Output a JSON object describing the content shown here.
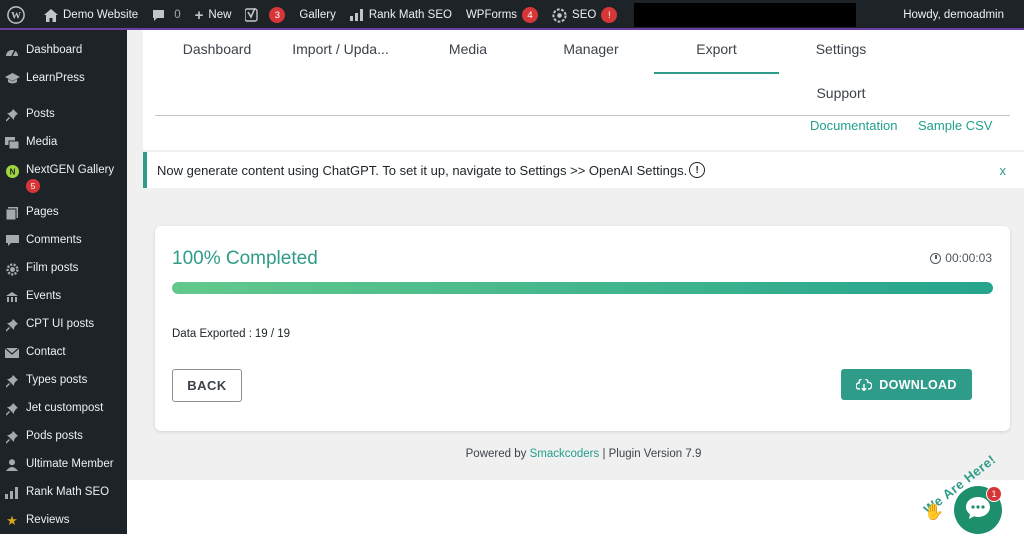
{
  "adminbar": {
    "site_name": "Demo Website",
    "comments_count": "0",
    "new_label": "New",
    "yoast_badge": "3",
    "gallery_label": "Gallery",
    "rankmath_label": "Rank Math SEO",
    "wpforms_label": "WPForms",
    "wpforms_badge": "4",
    "seo_label": "SEO",
    "seo_badge": "!",
    "howdy": "Howdy, demoadmin"
  },
  "sidebar": {
    "items": [
      {
        "label": "Dashboard",
        "icon": "dashboard-icon"
      },
      {
        "label": "LearnPress",
        "icon": "graduation-cap-icon"
      },
      {
        "label": "Posts",
        "icon": "pin-icon"
      },
      {
        "label": "Media",
        "icon": "media-icon"
      },
      {
        "label": "NextGEN Gallery",
        "icon": "gallery-icon",
        "badge": "5"
      },
      {
        "label": "Pages",
        "icon": "pages-icon"
      },
      {
        "label": "Comments",
        "icon": "comments-icon"
      },
      {
        "label": "Film posts",
        "icon": "gear-icon"
      },
      {
        "label": "Events",
        "icon": "events-icon"
      },
      {
        "label": "CPT UI posts",
        "icon": "pin-icon"
      },
      {
        "label": "Contact",
        "icon": "mail-icon"
      },
      {
        "label": "Types posts",
        "icon": "pin-icon"
      },
      {
        "label": "Jet custompost",
        "icon": "pin-icon"
      },
      {
        "label": "Pods posts",
        "icon": "pin-icon"
      },
      {
        "label": "Ultimate Member",
        "icon": "user-icon"
      },
      {
        "label": "Rank Math SEO",
        "icon": "chart-icon"
      },
      {
        "label": "Reviews",
        "icon": "star-icon"
      }
    ]
  },
  "tabs": {
    "dashboard": "Dashboard",
    "import": "Import / Upda...",
    "media": "Media",
    "manager": "Manager",
    "export": "Export",
    "settings": "Settings",
    "support": "Support"
  },
  "links": {
    "documentation": "Documentation",
    "sample_csv": "Sample CSV"
  },
  "notice": {
    "text": "Now generate content using ChatGPT. To set it up, navigate to Settings >> OpenAI Settings.",
    "info": "!",
    "close": "x"
  },
  "progress": {
    "title": "100% Completed",
    "timer": "00:00:03",
    "fraction": 1.0,
    "exported_label": "Data Exported :",
    "exported_value": "19 / 19",
    "back_label": "BACK",
    "download_label": "DOWNLOAD"
  },
  "footer": {
    "powered_by": "Powered by",
    "company": "Smackcoders",
    "version": "| Plugin Version 7.9"
  },
  "chat": {
    "tagline": "We Are Here!",
    "badge": "1"
  },
  "colors": {
    "accent": "#2e9c89",
    "admin_bar": "#1d2327",
    "badge": "#d63638"
  }
}
